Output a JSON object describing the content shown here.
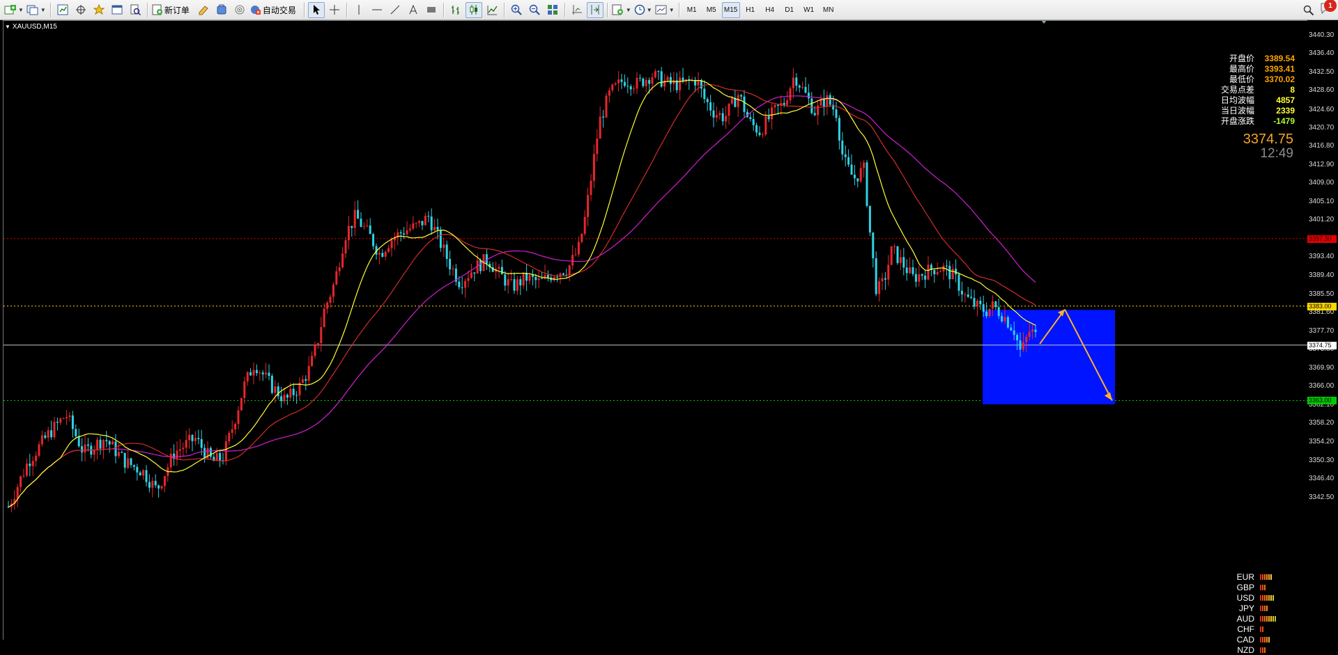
{
  "toolbar": {
    "new_order_label": "新订单",
    "auto_trading_label": "自动交易",
    "timeframes": [
      "M1",
      "M5",
      "M15",
      "H1",
      "H4",
      "D1",
      "W1",
      "MN"
    ],
    "active_timeframe": "M15",
    "notification_count": "1"
  },
  "chart": {
    "symbol_label": "XAUUSD,M15",
    "price_axis": [
      "3440.30",
      "3436.40",
      "3432.50",
      "3428.60",
      "3424.60",
      "3420.70",
      "3416.80",
      "3412.90",
      "3409.00",
      "3405.10",
      "3401.20",
      "3393.40",
      "3389.40",
      "3385.50",
      "3381.60",
      "3377.70",
      "3373.80",
      "3369.90",
      "3366.00",
      "3362.10",
      "3358.20",
      "3354.20",
      "3350.30",
      "3346.40",
      "3342.50"
    ],
    "level_red": "3397.30",
    "level_yellow": "3383.00",
    "level_current": "3374.75",
    "level_green": "3363.00",
    "colors": {
      "bull_candle": "#e8262c",
      "bear_candle": "#2fd3e6",
      "ma_fast": "#ffff33",
      "ma_mid": "#d42b2b",
      "ma_slow": "#d020d0",
      "zone": "#0014ff",
      "arrow": "#ffb12a"
    }
  },
  "info_panel": {
    "rows": [
      {
        "label": "开盘价",
        "value": "3389.54",
        "color": "#ffa500"
      },
      {
        "label": "最高价",
        "value": "3393.41",
        "color": "#ffa500"
      },
      {
        "label": "最低价",
        "value": "3370.02",
        "color": "#ffa500"
      },
      {
        "label": "交易点差",
        "value": "8",
        "color": "#ffff33"
      },
      {
        "label": "日均波幅",
        "value": "4857",
        "color": "#ffff33"
      },
      {
        "label": "当日波幅",
        "value": "2339",
        "color": "#ffff33"
      },
      {
        "label": "开盘涨跌",
        "value": "-1479",
        "color": "#adff2f"
      }
    ],
    "current_price": "3374.75",
    "countdown": "12:49"
  },
  "currency_strength": [
    {
      "code": "EUR",
      "level": 6
    },
    {
      "code": "GBP",
      "level": 3
    },
    {
      "code": "USD",
      "level": 7
    },
    {
      "code": "JPY",
      "level": 4
    },
    {
      "code": "AUD",
      "level": 8
    },
    {
      "code": "CHF",
      "level": 2
    },
    {
      "code": "CAD",
      "level": 5
    },
    {
      "code": "NZD",
      "level": 3
    }
  ]
}
